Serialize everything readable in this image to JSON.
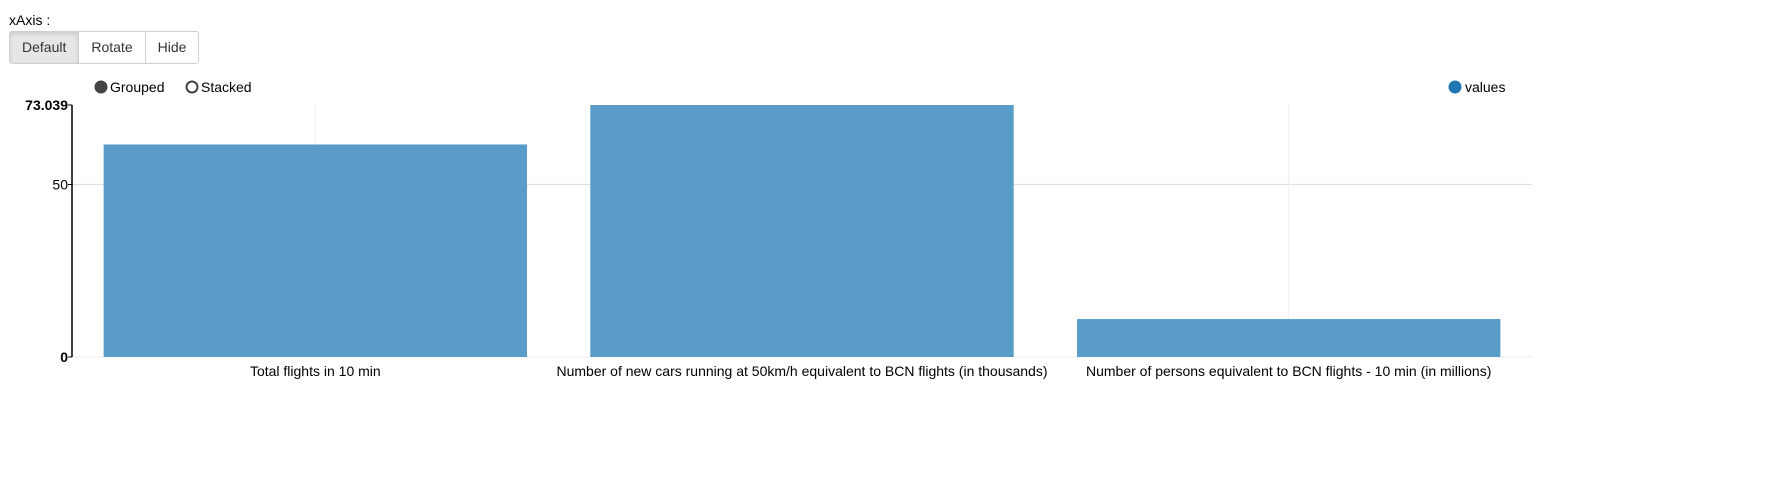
{
  "controls": {
    "axis_caption": "xAxis :",
    "buttons": [
      {
        "label": "Default",
        "active": true
      },
      {
        "label": "Rotate",
        "active": false
      },
      {
        "label": "Hide",
        "active": false
      }
    ]
  },
  "modes": {
    "grouped_label": "Grouped",
    "stacked_label": "Stacked",
    "selected": "grouped"
  },
  "colors": {
    "bar": "#5a9cc9",
    "legend_dot": "#1f77b4",
    "radio": "#444444",
    "grid": "#e0e0e0",
    "axis": "#000000"
  },
  "chart_data": {
    "type": "bar",
    "categories": [
      "Total flights in 10 min",
      "Number of new cars running at 50km/h equivalent to BCN flights (in thousands)",
      "Number of persons equivalent to BCN flights - 10 min (in millions)"
    ],
    "series": [
      {
        "name": "values",
        "values": [
          61.6,
          73.039,
          11
        ]
      }
    ],
    "ylim": [
      0,
      73.039
    ],
    "y_ticks": [
      "0",
      "50",
      "73.039"
    ],
    "title": "",
    "xlabel": "",
    "ylabel": "",
    "grid": true,
    "legend_position": "top-right"
  }
}
